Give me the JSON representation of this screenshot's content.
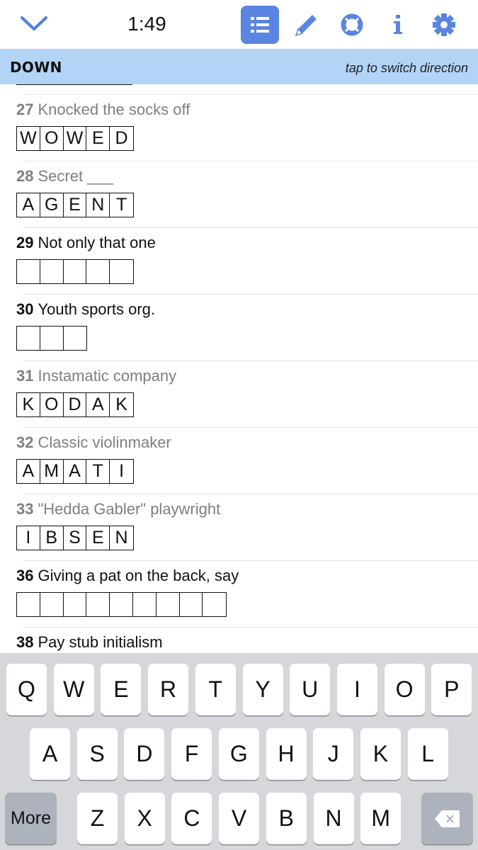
{
  "header": {
    "timer": "1:49",
    "icons": [
      "chevron-down-icon",
      "clue-list-icon",
      "pencil-icon",
      "lifebuoy-icon",
      "info-icon",
      "gear-icon"
    ],
    "accent_color": "#5a85e0"
  },
  "direction_bar": {
    "direction": "DOWN",
    "hint": "tap to switch direction",
    "background": "#b3d4f7"
  },
  "clues": [
    {
      "number": "27",
      "text": "Knocked the socks off",
      "answer": [
        "W",
        "O",
        "W",
        "E",
        "D"
      ],
      "solved": true
    },
    {
      "number": "28",
      "text": "Secret ___",
      "answer": [
        "A",
        "G",
        "E",
        "N",
        "T"
      ],
      "solved": true
    },
    {
      "number": "29",
      "text": "Not only that one",
      "answer": [
        "",
        "",
        "",
        "",
        ""
      ],
      "solved": false
    },
    {
      "number": "30",
      "text": "Youth sports org.",
      "answer": [
        "",
        "",
        ""
      ],
      "solved": false
    },
    {
      "number": "31",
      "text": "Instamatic company",
      "answer": [
        "K",
        "O",
        "D",
        "A",
        "K"
      ],
      "solved": true
    },
    {
      "number": "32",
      "text": "Classic violinmaker",
      "answer": [
        "A",
        "M",
        "A",
        "T",
        "I"
      ],
      "solved": true
    },
    {
      "number": "33",
      "text": "\"Hedda Gabler\" playwright",
      "answer": [
        "I",
        "B",
        "S",
        "E",
        "N"
      ],
      "solved": true
    },
    {
      "number": "36",
      "text": "Giving a pat on the back, say",
      "answer": [
        "",
        "",
        "",
        "",
        "",
        "",
        "",
        "",
        ""
      ],
      "solved": false
    },
    {
      "number": "38",
      "text": "Pay stub initialism",
      "answer": [],
      "solved": false
    }
  ],
  "keyboard": {
    "row1": [
      "Q",
      "W",
      "E",
      "R",
      "T",
      "Y",
      "U",
      "I",
      "O",
      "P"
    ],
    "row2": [
      "A",
      "S",
      "D",
      "F",
      "G",
      "H",
      "J",
      "K",
      "L"
    ],
    "row3": [
      "Z",
      "X",
      "C",
      "V",
      "B",
      "N",
      "M"
    ],
    "more_label": "More",
    "backspace_icon": "backspace-icon"
  }
}
